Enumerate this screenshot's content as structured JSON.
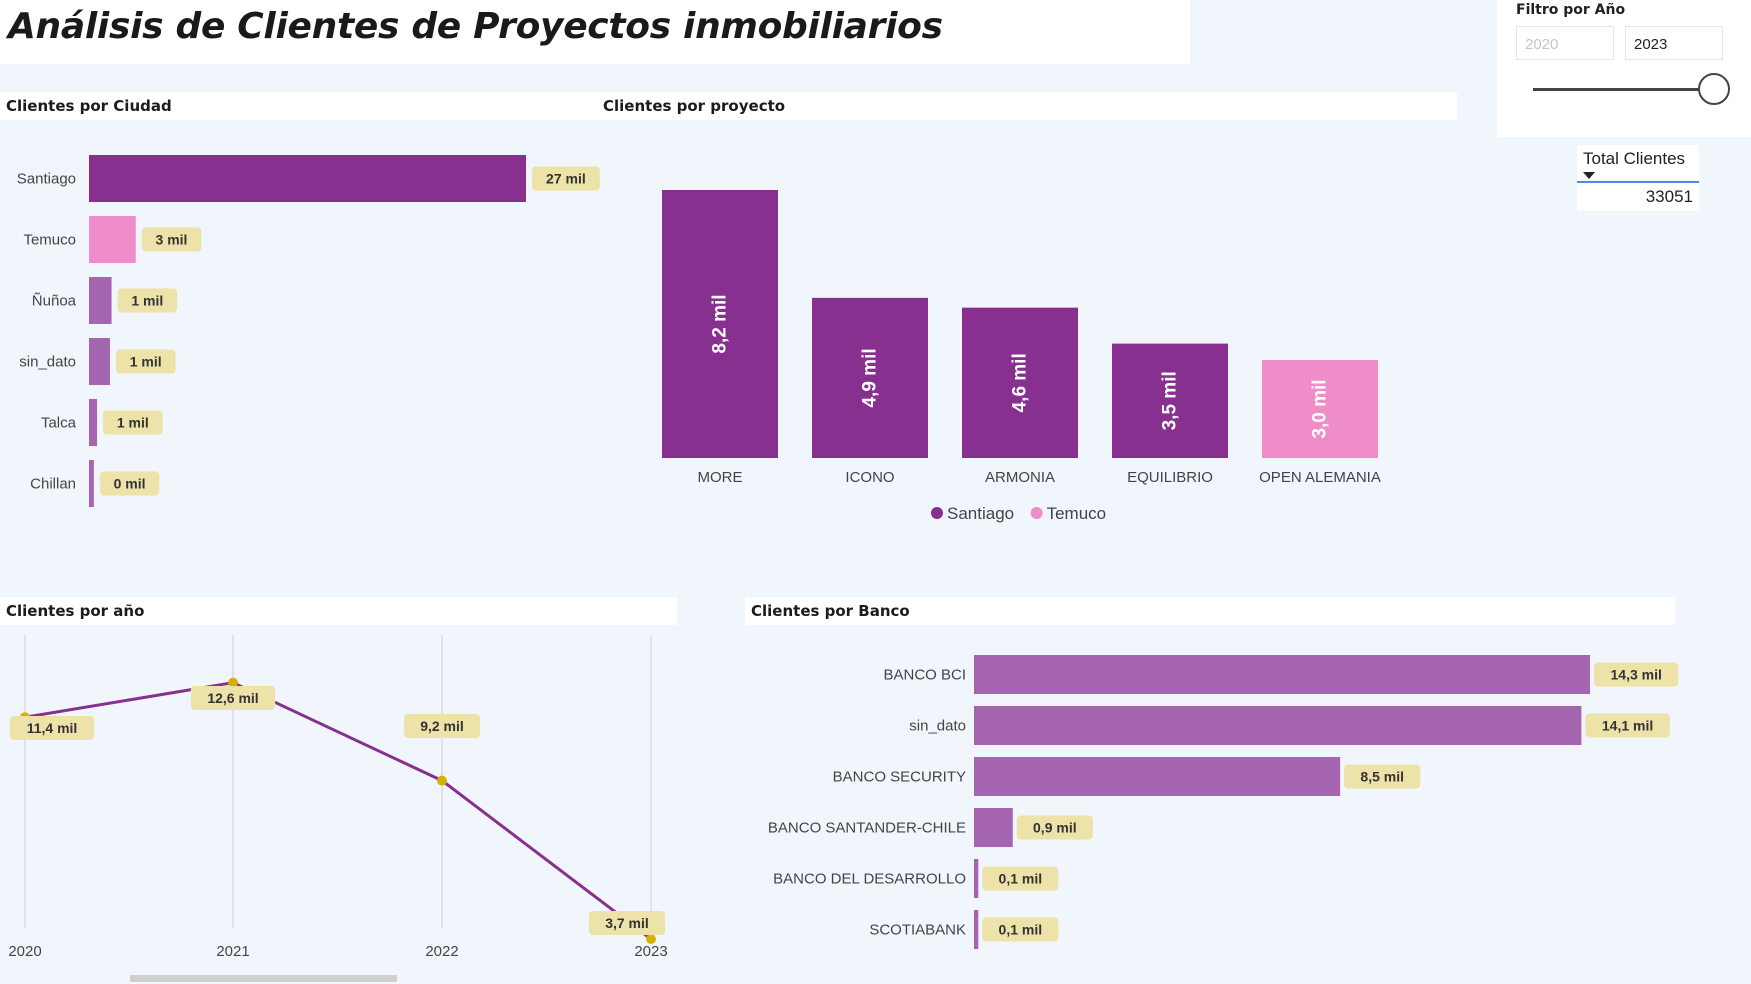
{
  "title": "Análisis de Clientes de Proyectos inmobiliarios",
  "colors": {
    "purple": "#88308f",
    "pink": "#ee8dc8",
    "lavender": "#a565b0",
    "label_bg": "#ede2a8",
    "dot": "#d4b106"
  },
  "slicer": {
    "title": "Filtro por Año",
    "from": "2020",
    "to": "2023"
  },
  "card": {
    "label": "Total Clientes",
    "value": "33051",
    "icon": "sort-down-icon"
  },
  "chart_data": [
    {
      "id": "ciudad",
      "type": "bar",
      "orientation": "horizontal",
      "title": "Clientes por Ciudad",
      "categories": [
        "Santiago",
        "Temuco",
        "Ñuñoa",
        "sin_dato",
        "Talca",
        "Chillan"
      ],
      "values": [
        27.1,
        2.9,
        1.4,
        1.3,
        0.5,
        0.3
      ],
      "value_labels": [
        "27 mil",
        "3 mil",
        "1 mil",
        "1 mil",
        "1 mil",
        "0 mil"
      ],
      "colors": [
        "#88308f",
        "#ee8dc8",
        "#a565b0",
        "#a565b0",
        "#a565b0",
        "#a565b0"
      ]
    },
    {
      "id": "proyecto",
      "type": "bar",
      "title": "Clientes por proyecto",
      "categories": [
        "MORE",
        "ICONO",
        "ARMONIA",
        "EQUILIBRIO",
        "OPEN ALEMANIA"
      ],
      "values": [
        8.2,
        4.9,
        4.6,
        3.5,
        3.0
      ],
      "value_labels": [
        "8,2 mil",
        "4,9 mil",
        "4,6 mil",
        "3,5 mil",
        "3,0 mil"
      ],
      "series_by_bar": [
        "Santiago",
        "Santiago",
        "Santiago",
        "Santiago",
        "Temuco"
      ],
      "legend": [
        {
          "name": "Santiago",
          "color": "#88308f"
        },
        {
          "name": "Temuco",
          "color": "#ee8dc8"
        }
      ]
    },
    {
      "id": "anio",
      "type": "line",
      "title": "Clientes por año",
      "x": [
        "2020",
        "2021",
        "2022",
        "2023"
      ],
      "values": [
        11.4,
        12.6,
        9.2,
        3.7
      ],
      "value_labels": [
        "11,4 mil",
        "12,6 mil",
        "9,2 mil",
        "3,7 mil"
      ],
      "grid": true
    },
    {
      "id": "banco",
      "type": "bar",
      "orientation": "horizontal",
      "title": "Clientes por Banco",
      "categories": [
        "BANCO BCI",
        "sin_dato",
        "BANCO SECURITY",
        "BANCO SANTANDER-CHILE",
        "BANCO DEL DESARROLLO",
        "SCOTIABANK"
      ],
      "values": [
        14.3,
        14.1,
        8.5,
        0.9,
        0.1,
        0.1
      ],
      "value_labels": [
        "14,3 mil",
        "14,1 mil",
        "8,5 mil",
        "0,9 mil",
        "0,1 mil",
        "0,1 mil"
      ]
    }
  ]
}
